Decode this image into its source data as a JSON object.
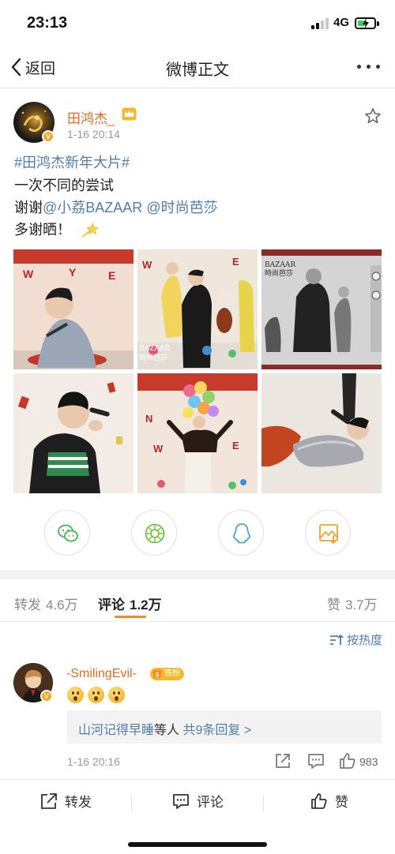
{
  "status_bar": {
    "time": "23:13",
    "network": "4G",
    "battery_level": 0.6
  },
  "nav": {
    "back_label": "返回",
    "title": "微博正文",
    "more_icon": "more-dots-icon"
  },
  "post": {
    "author": "田鸿杰_",
    "verified_icon": "verified-v-icon",
    "crown_icon": "crown-icon",
    "time": "1-16 20:14",
    "hashtag": "#田鸿杰新年大片#",
    "line2": "一次不同的尝试",
    "line3_prefix": "谢谢",
    "mention1": "@小荔BAZAAR",
    "mention2": "@时尚芭莎",
    "line4": "多谢晒！",
    "star_icon": "star-icon",
    "photos": [
      {
        "caption": ""
      },
      {
        "caption": ""
      },
      {
        "caption": ""
      },
      {
        "caption": ""
      },
      {
        "caption": ""
      },
      {
        "caption": ""
      }
    ],
    "photo_logo_1": "BAZAAR",
    "photo_logo_2": "時尚芭莎",
    "photo_logo_3": "BAZAAR",
    "photo_logo_4": "時尚芭莎"
  },
  "share": [
    {
      "icon": "wechat-icon"
    },
    {
      "icon": "moments-icon"
    },
    {
      "icon": "qq-icon"
    },
    {
      "icon": "save-image-icon"
    }
  ],
  "tabs": {
    "repost_label": "转发",
    "repost_count": "4.6万",
    "comment_label": "评论",
    "comment_count": "1.2万",
    "like_label": "赞",
    "like_count": "3.7万"
  },
  "sort": {
    "label": "按热度"
  },
  "comment": {
    "user": "-SmilingEvil-",
    "fan_badge": "铁粉",
    "fan_level": "5",
    "replies_user": "山河记得早睡",
    "replies_mid": "等人",
    "replies_count": "共9条回复 >",
    "time": "1-16 20:16",
    "like_count": "983"
  },
  "bottom_bar": {
    "repost": "转发",
    "comment": "评论",
    "like": "赞"
  },
  "colors": {
    "accent_orange": "#e86b1f",
    "link_blue": "#507daf",
    "tab_underline": "#f08a2a"
  }
}
